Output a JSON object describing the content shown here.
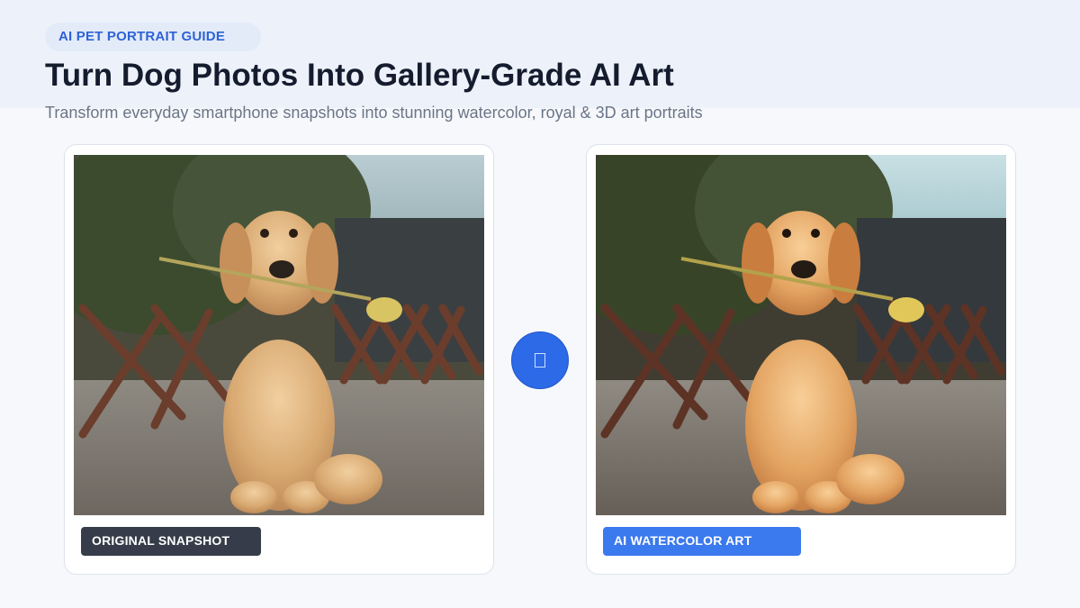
{
  "header": {
    "badge": "AI PET PORTRAIT GUIDE",
    "title": "Turn Dog Photos Into Gallery-Grade AI Art",
    "subtitle": "Transform everyday smartphone snapshots into stunning watercolor, royal & 3D art portraits"
  },
  "comparison": {
    "original": {
      "label": "ORIGINAL SNAPSHOT"
    },
    "result": {
      "label": "AI WATERCOLOR ART"
    },
    "arrow_icon": "arrow-right-icon"
  },
  "colors": {
    "accent": "#2d6ae8",
    "label_dark": "#363c49",
    "label_blue": "#3b79ee",
    "title": "#141c2e"
  }
}
